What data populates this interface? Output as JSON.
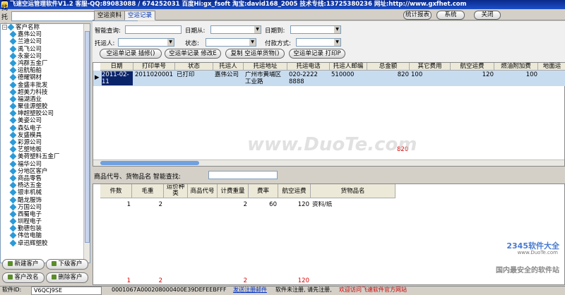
{
  "window": {
    "title": "飞速空运管理软件V1.2 客服-QQ:89083088 / 674252031 百度Hi:gx_fsoft 淘宝:david168_2005 技术专线:13725380236 网址:http://www.gxfhet.com"
  },
  "left": {
    "search_label": "查找托运人:",
    "search_value": ""
  },
  "tree": {
    "root": "客户名称",
    "items": [
      "嘉伟公司",
      "兰迪公司",
      "禹飞公司",
      "永豪公司",
      "鸿群五金厂",
      "运航船舶",
      "德耀钢材",
      "金盛丰批发",
      "超美力科技",
      "福湖酒业",
      "聚佳源塑胶",
      "坤超塑胶公司",
      "美姿公司",
      "森弘电子",
      "友盛模具",
      "彩源公司",
      "艺塑地板",
      "美荷塑料五金厂",
      "福华公司",
      "分地区客户",
      "商品零售",
      "杨达五金",
      "银丰机械",
      "酷龙服饰",
      "万国公司",
      "西蜀电子",
      "圳程电子",
      "勤德包装",
      "伟信电脑",
      "卓迅辉塑胶"
    ]
  },
  "left_buttons": [
    "新建客户",
    "下级客户",
    "客户改名",
    "删除客户"
  ],
  "tabs": [
    "空运资料",
    "空运记录"
  ],
  "top_buttons": [
    "统计报表",
    "系统",
    "关闭"
  ],
  "filters": {
    "smart_label": "智能查询:",
    "date_from": "日期从:",
    "date_to": "日期到:",
    "shipper": "托运人:",
    "status": "状态:",
    "payment": "付款方式:"
  },
  "actions": [
    "空运单记录 插修()",
    "空运单记录 修改E",
    "复制 空运单货物()",
    "空运单记录 打印P"
  ],
  "grid1": {
    "headers": [
      "日期",
      "打印单号",
      "状态",
      "托运人",
      "托运地址",
      "托运电话",
      "托运人邮编",
      "总金额",
      "其它费用",
      "航空运费",
      "燃油附加费",
      "地面运"
    ],
    "row": [
      "2011-02-11",
      "2011020001",
      "已打印",
      "嘉伟公司",
      "广州市黄埔区工业路",
      "020-2222 8888",
      "510000",
      "820",
      "100",
      "120",
      "100",
      ""
    ],
    "total": "820"
  },
  "goods": {
    "label": "商品代号、货物品名 智能查找:",
    "headers": [
      "件数",
      "毛重",
      "运价种类",
      "商品代号",
      "计费重量",
      "费率",
      "航空运费",
      "货物品名"
    ],
    "row": [
      "1",
      "2",
      "",
      "",
      "2",
      "60",
      "120",
      "资料/纸"
    ],
    "totals": [
      "1",
      "2",
      "",
      "",
      "2",
      "",
      "120",
      ""
    ]
  },
  "status": {
    "id_label": "软件ID:",
    "id_value": "V6QCJ9SE",
    "reg_value": "0001067A000208000400E39DEFEEBFFF",
    "reg_link": "发送注册邮件",
    "unreg": "软件未注册, 请先注册,",
    "visit": "欢迎访问飞速软件官方网站"
  },
  "watermark": "www.DuoTe.com",
  "badge": {
    "top": "2345软件大全",
    "mid": "www.DuoTe.com",
    "bottom": "国内最安全的软件站"
  }
}
